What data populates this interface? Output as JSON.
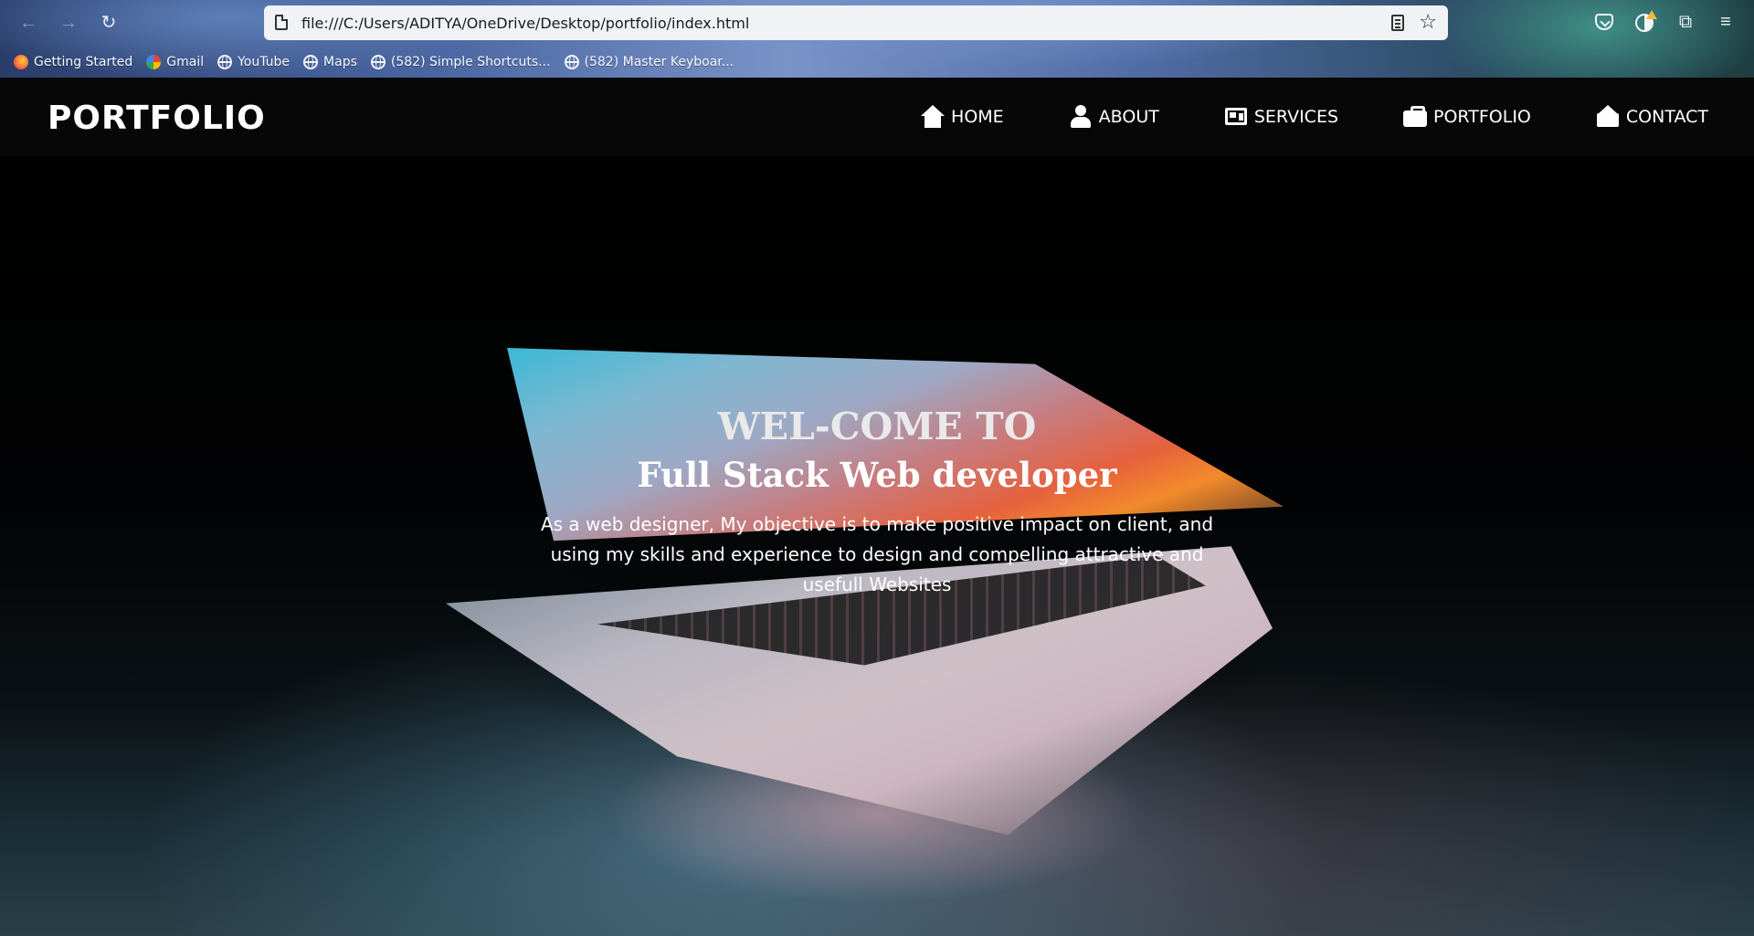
{
  "browser": {
    "url": "file:///C:/Users/ADITYA/OneDrive/Desktop/portfolio/index.html",
    "bookmarks": [
      {
        "label": "Getting Started",
        "icon": "firefox-icon"
      },
      {
        "label": "Gmail",
        "icon": "google-icon"
      },
      {
        "label": "YouTube",
        "icon": "globe-icon"
      },
      {
        "label": "Maps",
        "icon": "globe-icon"
      },
      {
        "label": "(582) Simple Shortcuts...",
        "icon": "globe-icon"
      },
      {
        "label": "(582) Master Keyboar...",
        "icon": "globe-icon"
      }
    ]
  },
  "site": {
    "logo": "PORTFOLIO",
    "menu": [
      {
        "label": "HOME",
        "icon": "home-icon"
      },
      {
        "label": "ABOUT",
        "icon": "user-icon"
      },
      {
        "label": "SERVICES",
        "icon": "newspaper-icon"
      },
      {
        "label": "PORTFOLIO",
        "icon": "briefcase-icon"
      },
      {
        "label": "CONTACT",
        "icon": "envelope-open-icon"
      }
    ]
  },
  "hero": {
    "title1": "WEL-COME TO",
    "title2": "Full Stack Web developer",
    "text": "As a web designer, My objective is to make positive impact on client, and using my skills and experience to design and compelling attractive and usefull Websites"
  },
  "colors": {
    "navbar_bg": "#070707",
    "text": "#ffffff"
  }
}
